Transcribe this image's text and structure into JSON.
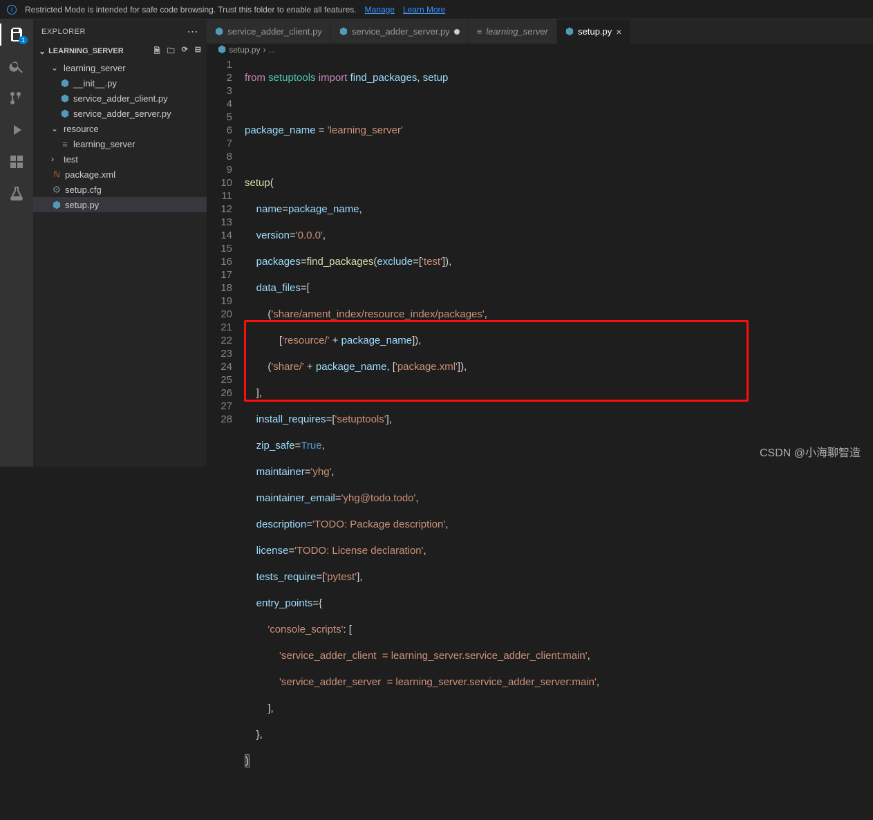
{
  "notification": {
    "text": "Restricted Mode is intended for safe code browsing. Trust this folder to enable all features.",
    "manage": "Manage",
    "learn": "Learn More"
  },
  "explorer": {
    "title": "EXPLORER",
    "project": "LEARNING_SERVER"
  },
  "tree": {
    "folder1": "learning_server",
    "file1": "__init__.py",
    "file2": "service_adder_client.py",
    "file3": "service_adder_server.py",
    "folder2": "resource",
    "file4": "learning_server",
    "folder3": "test",
    "file5": "package.xml",
    "file6": "setup.cfg",
    "file7": "setup.py"
  },
  "tabs": {
    "t1": "service_adder_client.py",
    "t2": "service_adder_server.py",
    "t3": "learning_server",
    "t4": "setup.py"
  },
  "breadcrumb": {
    "file": "setup.py",
    "sep": "›",
    "rest": "..."
  },
  "activity_badge": "1",
  "code": {
    "lines": [
      "1",
      "2",
      "3",
      "4",
      "5",
      "6",
      "7",
      "8",
      "9",
      "10",
      "11",
      "12",
      "13",
      "14",
      "15",
      "16",
      "17",
      "18",
      "19",
      "20",
      "21",
      "22",
      "23",
      "24",
      "25",
      "26",
      "27",
      "28"
    ],
    "l1": {
      "from": "from",
      "mod": "setuptools",
      "imp": "import",
      "a": "find_packages",
      "c": ",",
      "b": "setup"
    },
    "l3": {
      "v": "package_name",
      "eq": " = ",
      "s": "'learning_server'"
    },
    "l5": {
      "fn": "setup",
      "p": "("
    },
    "l6": {
      "k": "name",
      "eq": "=",
      "v": "package_name",
      "c": ","
    },
    "l7": {
      "k": "version",
      "eq": "=",
      "s": "'0.0.0'",
      "c": ","
    },
    "l8": {
      "k": "packages",
      "eq": "=",
      "fn": "find_packages",
      "p1": "(",
      "ex": "exclude",
      "eq2": "=[",
      "s": "'test'",
      "p2": "]),"
    },
    "l9": {
      "k": "data_files",
      "eq": "=["
    },
    "l10": {
      "p1": "(",
      "s1": "'share/ament_index/resource_index/packages'",
      "c": ","
    },
    "l11": {
      "p1": "[",
      "s": "'resource/'",
      "op": " + ",
      "v": "package_name",
      "p2": "]),"
    },
    "l12": {
      "p1": "(",
      "s1": "'share/'",
      "op": " + ",
      "v": "package_name",
      "c": ", [",
      "s2": "'package.xml'",
      "p2": "]),"
    },
    "l13": {
      "b": "],"
    },
    "l14": {
      "k": "install_requires",
      "eq": "=[",
      "s": "'setuptools'",
      "p": "],"
    },
    "l15": {
      "k": "zip_safe",
      "eq": "=",
      "v": "True",
      "c": ","
    },
    "l16": {
      "k": "maintainer",
      "eq": "=",
      "s": "'yhg'",
      "c": ","
    },
    "l17": {
      "k": "maintainer_email",
      "eq": "=",
      "s": "'yhg@todo.todo'",
      "c": ","
    },
    "l18": {
      "k": "description",
      "eq": "=",
      "s": "'TODO: Package description'",
      "c": ","
    },
    "l19": {
      "k": "license",
      "eq": "=",
      "s": "'TODO: License declaration'",
      "c": ","
    },
    "l20": {
      "k": "tests_require",
      "eq": "=[",
      "s": "'pytest'",
      "p": "],"
    },
    "l21": {
      "k": "entry_points",
      "eq": "={"
    },
    "l22": {
      "s": "'console_scripts'",
      "c": ": ["
    },
    "l23": {
      "s": "'service_adder_client  = learning_server.service_adder_client:main'",
      "c": ","
    },
    "l24": {
      "s": "'service_adder_server  = learning_server.service_adder_server:main'",
      "c": ","
    },
    "l25": {
      "b": "],"
    },
    "l26": {
      "b": "},"
    },
    "l27": {
      "b": ")"
    }
  },
  "watermark": "CSDN @小海聊智造"
}
